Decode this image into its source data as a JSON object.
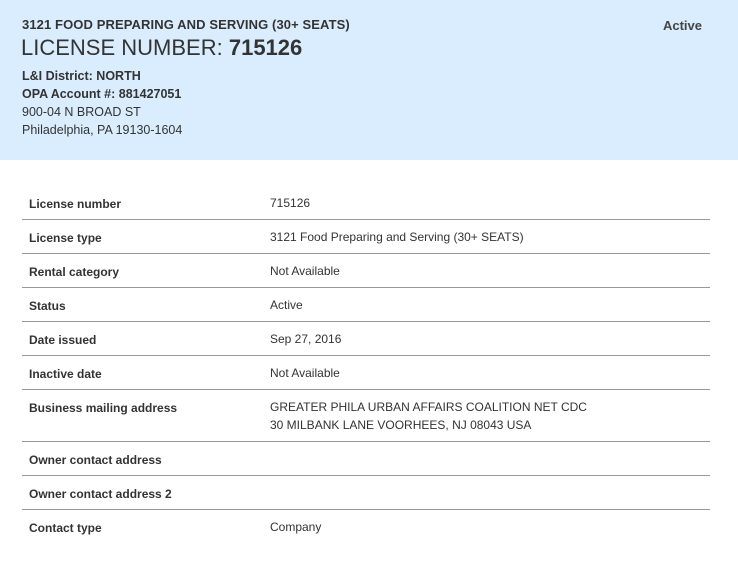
{
  "header": {
    "license_description": "3121 FOOD PREPARING AND SERVING (30+ SEATS)",
    "status": "Active",
    "license_title_prefix": "LICENSE NUMBER:",
    "license_number": "715126",
    "district": "L&I District: NORTH",
    "opa_account": "OPA Account #: 881427051",
    "address_line1": "900-04 N BROAD ST",
    "address_line2": "Philadelphia, PA 19130-1604"
  },
  "details": {
    "rows": [
      {
        "label": "License number",
        "value": "715126"
      },
      {
        "label": "License type",
        "value": "3121 Food Preparing and Serving (30+ SEATS)"
      },
      {
        "label": "Rental category",
        "value": "Not Available"
      },
      {
        "label": "Status",
        "value": "Active"
      },
      {
        "label": "Date issued",
        "value": "Sep 27, 2016"
      },
      {
        "label": "Inactive date",
        "value": "Not Available"
      },
      {
        "label": "Business mailing address",
        "value_line1": "GREATER PHILA URBAN AFFAIRS COALITION NET CDC",
        "value_line2": "30 MILBANK LANE VOORHEES, NJ 08043 USA"
      },
      {
        "label": "Owner contact address",
        "value": ""
      },
      {
        "label": "Owner contact address 2",
        "value": ""
      },
      {
        "label": "Contact type",
        "value": "Company"
      }
    ]
  }
}
